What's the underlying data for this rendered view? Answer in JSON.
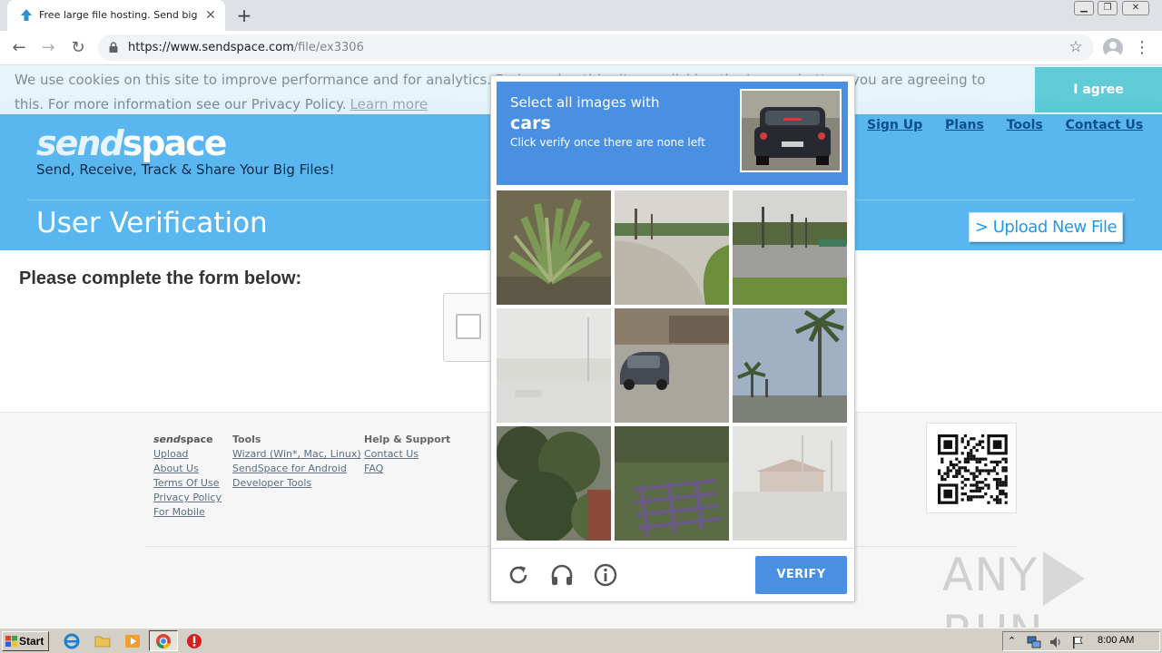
{
  "browser": {
    "tab_title": "Free large file hosting. Send big files",
    "tab_close": "✕",
    "new_tab": "+",
    "url_host": "https://www.sendspace.com",
    "url_path": "/file/ex3306"
  },
  "cookie": {
    "text": "We use cookies on this site to improve performance and for analytics. By browsing this site, or clicking the I agree button, you are agreeing to this. For more information see our Privacy Policy.",
    "learn_more": "Learn more",
    "agree": "I agree"
  },
  "header": {
    "logo_light": "send",
    "logo_strong": "space",
    "tagline": "Send, Receive, Track & Share Your Big Files!",
    "nav": {
      "signup": "Sign Up",
      "plans": "Plans",
      "tools": "Tools",
      "contact": "Contact Us"
    },
    "page_title": "User Verification",
    "upload_button": "> Upload New File"
  },
  "main": {
    "form_heading": "Please complete the form below:"
  },
  "captcha": {
    "line1": "Select all images with",
    "target": "cars",
    "line3": "Click verify once there are none left",
    "verify": "VERIFY",
    "icons": [
      "reload-icon",
      "headphones-icon",
      "info-icon"
    ],
    "tiles": [
      {
        "label": "palm-shrub"
      },
      {
        "label": "curving-road"
      },
      {
        "label": "road-with-poles"
      },
      {
        "label": "faded-street"
      },
      {
        "label": "car-on-street"
      },
      {
        "label": "palm-trees"
      },
      {
        "label": "hedge-bushes"
      },
      {
        "label": "metal-rack-in-grass"
      },
      {
        "label": "faded-building"
      }
    ],
    "accent": "#4a90e2"
  },
  "footer": {
    "col1": {
      "heading_light": "send",
      "heading_strong": "space",
      "links": [
        "Upload",
        "About Us",
        "Terms Of Use",
        "Privacy Policy",
        "For Mobile"
      ]
    },
    "col2": {
      "heading": "Tools",
      "links": [
        "Wizard (Win*, Mac, Linux)",
        "SendSpace for Android",
        "Developer Tools"
      ]
    },
    "col3": {
      "heading": "Help & Support",
      "links": [
        "Contact Us",
        "FAQ"
      ]
    },
    "watermark_left": "ANY",
    "watermark_right": "RUN"
  },
  "taskbar": {
    "start": "Start",
    "clock": "8:00 AM"
  }
}
